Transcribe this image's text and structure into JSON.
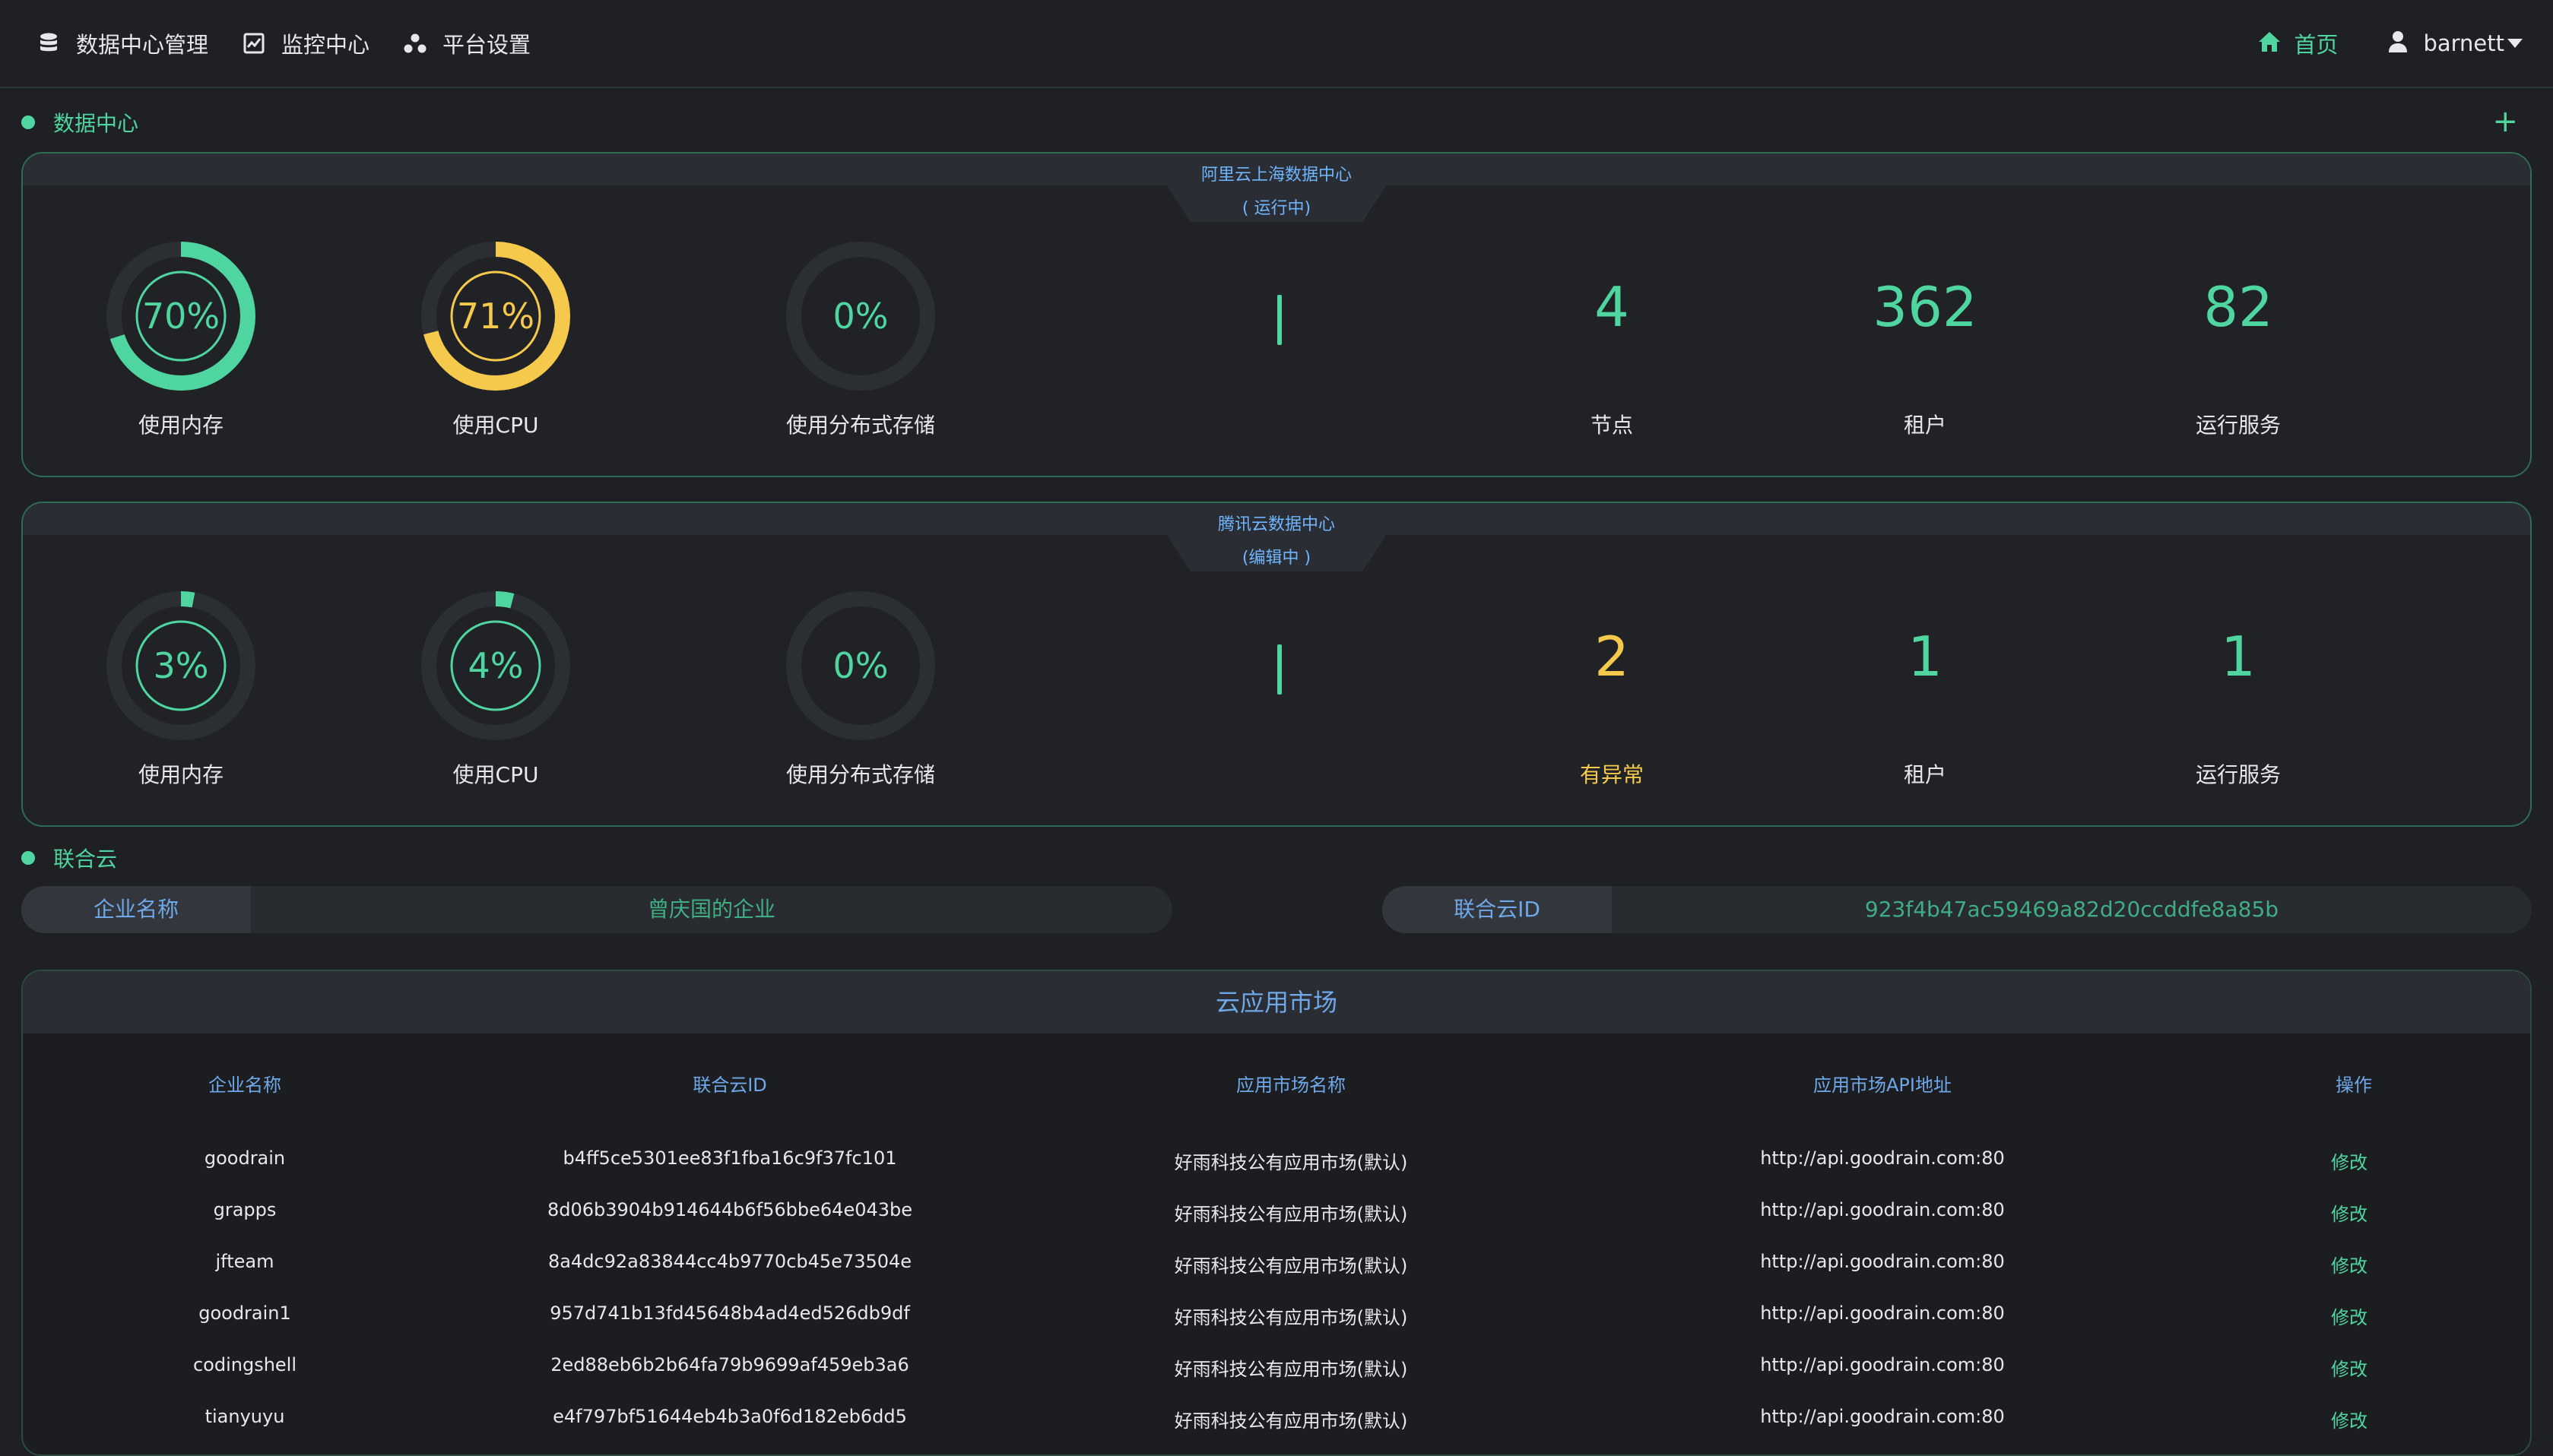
{
  "nav": {
    "items": [
      {
        "label": "数据中心管理",
        "icon": "database-icon"
      },
      {
        "label": "监控中心",
        "icon": "chart-icon"
      },
      {
        "label": "平台设置",
        "icon": "cluster-icon"
      }
    ],
    "home": "首页",
    "user": "barnett"
  },
  "sections": {
    "datacenter": "数据中心",
    "federation": "联合云"
  },
  "datacenters": [
    {
      "name": "阿里云上海数据中心",
      "status": "( 运行中)",
      "memory": {
        "percent": 70,
        "text": "70%",
        "label": "使用内存",
        "color": "#4fd6a0"
      },
      "cpu": {
        "percent": 71,
        "text": "71%",
        "label": "使用CPU",
        "color": "#f4c94c"
      },
      "storage": {
        "percent": 0,
        "text": "0%",
        "label": "使用分布式存储",
        "color": "#4fd6a0"
      },
      "stats": [
        {
          "value": "4",
          "label": "节点",
          "value_color": "#4fd6a0",
          "label_color": "#e6e8eb"
        },
        {
          "value": "362",
          "label": "租户",
          "value_color": "#4fd6a0",
          "label_color": "#e6e8eb"
        },
        {
          "value": "82",
          "label": "运行服务",
          "value_color": "#4fd6a0",
          "label_color": "#e6e8eb"
        }
      ]
    },
    {
      "name": "腾讯云数据中心",
      "status": "(编辑中 )",
      "memory": {
        "percent": 3,
        "text": "3%",
        "label": "使用内存",
        "color": "#4fd6a0"
      },
      "cpu": {
        "percent": 4,
        "text": "4%",
        "label": "使用CPU",
        "color": "#4fd6a0"
      },
      "storage": {
        "percent": 0,
        "text": "0%",
        "label": "使用分布式存储",
        "color": "#4fd6a0"
      },
      "stats": [
        {
          "value": "2",
          "label": "有异常",
          "value_color": "#f4c94c",
          "label_color": "#f4c94c"
        },
        {
          "value": "1",
          "label": "租户",
          "value_color": "#4fd6a0",
          "label_color": "#e6e8eb"
        },
        {
          "value": "1",
          "label": "运行服务",
          "value_color": "#4fd6a0",
          "label_color": "#e6e8eb"
        }
      ]
    }
  ],
  "federation": {
    "company_key": "企业名称",
    "company_val": "曾庆国的企业",
    "id_key": "联合云ID",
    "id_val": "923f4b47ac59469a82d20ccddfe8a85b"
  },
  "market": {
    "title": "云应用市场",
    "columns": [
      "企业名称",
      "联合云ID",
      "应用市场名称",
      "应用市场API地址",
      "操作"
    ],
    "rows": [
      [
        "goodrain",
        "b4ff5ce5301ee83f1fba16c9f37fc101",
        "好雨科技公有应用市场(默认)",
        "http://api.goodrain.com:80",
        "修改"
      ],
      [
        "grapps",
        "8d06b3904b914644b6f56bbe64e043be",
        "好雨科技公有应用市场(默认)",
        "http://api.goodrain.com:80",
        "修改"
      ],
      [
        "jfteam",
        "8a4dc92a83844cc4b9770cb45e73504e",
        "好雨科技公有应用市场(默认)",
        "http://api.goodrain.com:80",
        "修改"
      ],
      [
        "goodrain1",
        "957d741b13fd45648b4ad4ed526db9df",
        "好雨科技公有应用市场(默认)",
        "http://api.goodrain.com:80",
        "修改"
      ],
      [
        "codingshell",
        "2ed88eb6b2b64fa79b9699af459eb3a6",
        "好雨科技公有应用市场(默认)",
        "http://api.goodrain.com:80",
        "修改"
      ],
      [
        "tianyuyu",
        "e4f797bf51644eb4b3a0f6d182eb6dd5",
        "好雨科技公有应用市场(默认)",
        "http://api.goodrain.com:80",
        "修改"
      ]
    ]
  }
}
